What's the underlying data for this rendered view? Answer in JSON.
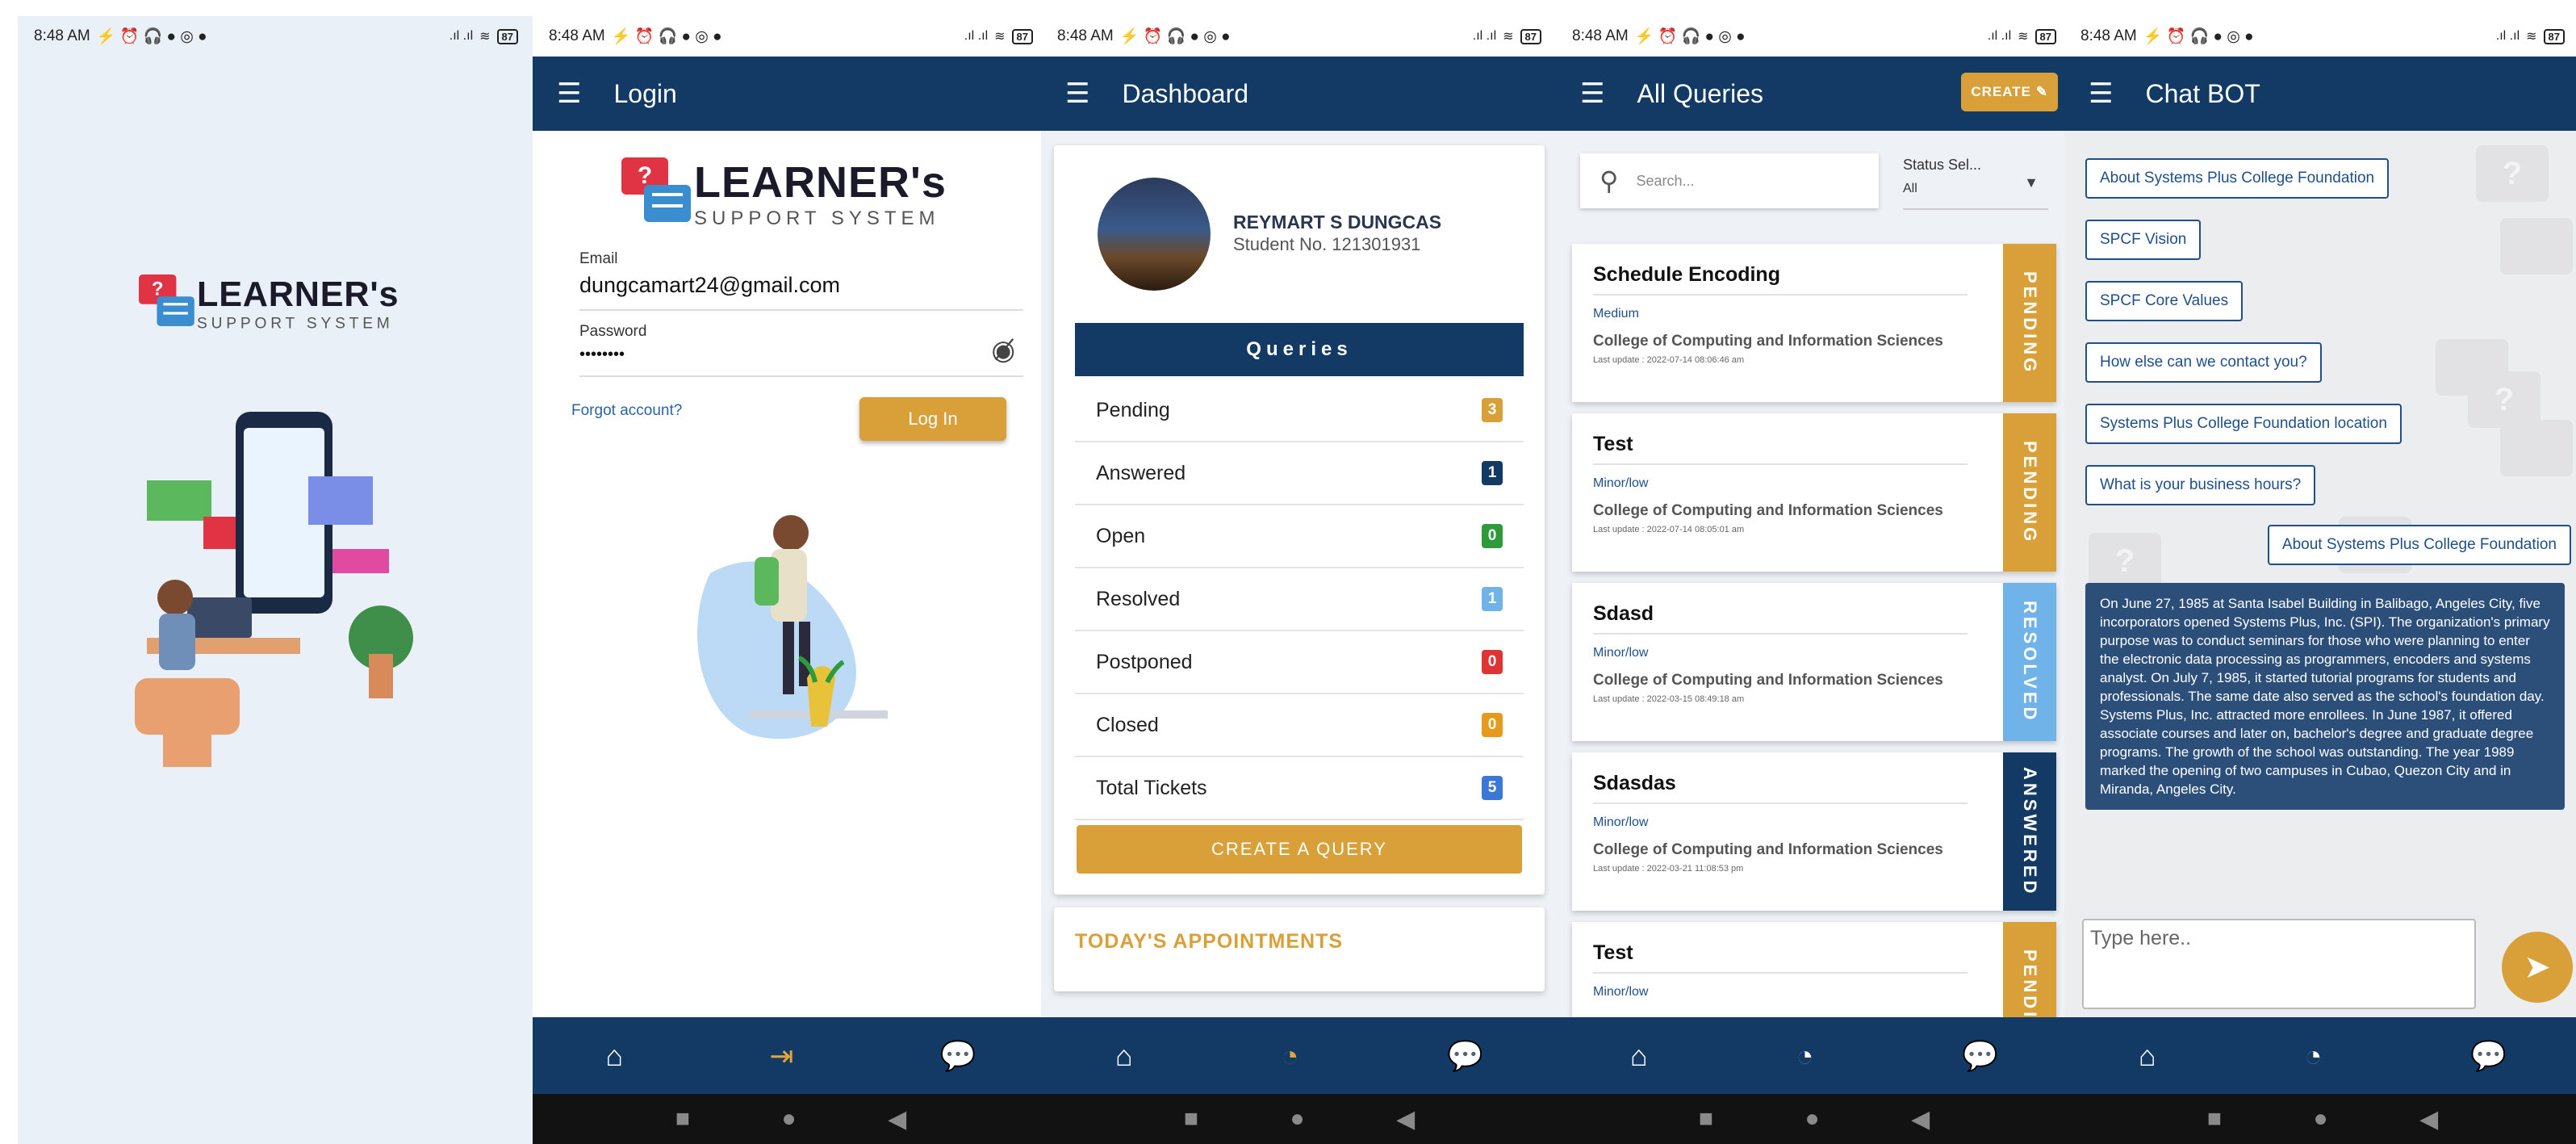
{
  "status_bar": {
    "time": "8:48 AM",
    "icons": "⚡ ⏰ 🎧 ● ◎ ●",
    "signal": ".ıl .ıl",
    "wifi": "≋",
    "battery": "87"
  },
  "logo": {
    "line1": "LEARNER's",
    "line2": "SUPPORT SYSTEM",
    "badge": "?"
  },
  "login": {
    "title": "Login",
    "email_label": "Email",
    "email_value": "dungcamart24@gmail.com",
    "password_label": "Password",
    "password_value": "••••••••",
    "forgot": "Forgot account?",
    "login_button": "Log In"
  },
  "dashboard": {
    "title": "Dashboard",
    "name": "REYMART S DUNGCAS",
    "student_no": "Student No. 121301931",
    "queries_header": "Queries",
    "rows": [
      {
        "label": "Pending",
        "count": "3",
        "color": "#d9a03a"
      },
      {
        "label": "Answered",
        "count": "1",
        "color": "#123a64"
      },
      {
        "label": "Open",
        "count": "0",
        "color": "#2e9a3a"
      },
      {
        "label": "Resolved",
        "count": "1",
        "color": "#6fb3e8"
      },
      {
        "label": "Postponed",
        "count": "0",
        "color": "#e03333"
      },
      {
        "label": "Closed",
        "count": "0",
        "color": "#e59a1e"
      },
      {
        "label": "Total Tickets",
        "count": "5",
        "color": "#3a78d8"
      }
    ],
    "create_button": "CREATE A QUERY",
    "appointments": "TODAY'S APPOINTMENTS"
  },
  "queries": {
    "title": "All Queries",
    "create": "CREATE",
    "search_placeholder": "Search...",
    "status_label": "Status Sel...",
    "status_value": "All",
    "tickets": [
      {
        "title": "Schedule Encoding",
        "priority": "Medium",
        "college": "College of Computing and Information Sciences",
        "update": "Last update : 2022-07-14 08:06:46 am",
        "status": "PENDING",
        "color": "#d9a03a"
      },
      {
        "title": "Test",
        "priority": "Minor/low",
        "college": "College of Computing and Information Sciences",
        "update": "Last update : 2022-07-14 08:05:01 am",
        "status": "PENDING",
        "color": "#d9a03a"
      },
      {
        "title": "Sdasd",
        "priority": "Minor/low",
        "college": "College of Computing and Information Sciences",
        "update": "Last update : 2022-03-15 08:49:18 am",
        "status": "RESOLVED",
        "color": "#6fb3e8"
      },
      {
        "title": "Sdasdas",
        "priority": "Minor/low",
        "college": "College of Computing and Information Sciences",
        "update": "Last update : 2022-03-21 11:08:53 pm",
        "status": "ANSWERED",
        "color": "#123a64"
      },
      {
        "title": "Test",
        "priority": "Minor/low",
        "college": "",
        "update": "",
        "status": "PENDING",
        "color": "#d9a03a"
      }
    ]
  },
  "chatbot": {
    "title": "Chat BOT",
    "chips": [
      "About Systems Plus College Foundation",
      "SPCF Vision",
      "SPCF Core Values",
      "How else can we contact you?",
      "Systems Plus College Foundation location",
      "What is your business hours?"
    ],
    "user_message": "About Systems Plus College Foundation",
    "bot_message": "On June 27, 1985 at Santa Isabel Building in Balibago, Angeles City, five incorporators opened Systems Plus, Inc. (SPI). The organization's primary purpose was to conduct seminars for those who were planning to enter the electronic data processing as programmers, encoders and systems analyst. On July 7, 1985, it started tutorial programs for students and professionals. The same date also served as the school's foundation day. Systems Plus, Inc. attracted more enrollees. In June 1987, it offered associate courses and later on, bachelor's degree and graduate degree programs. The growth of the school was outstanding. The year 1989 marked the opening of two campuses in Cubao, Quezon City and in Miranda, Angeles City.",
    "input_placeholder": "Type here.."
  },
  "nav": {
    "home": "home-icon",
    "login": "login-icon",
    "dashboard": "dashboard-icon",
    "chat": "chat-icon"
  }
}
